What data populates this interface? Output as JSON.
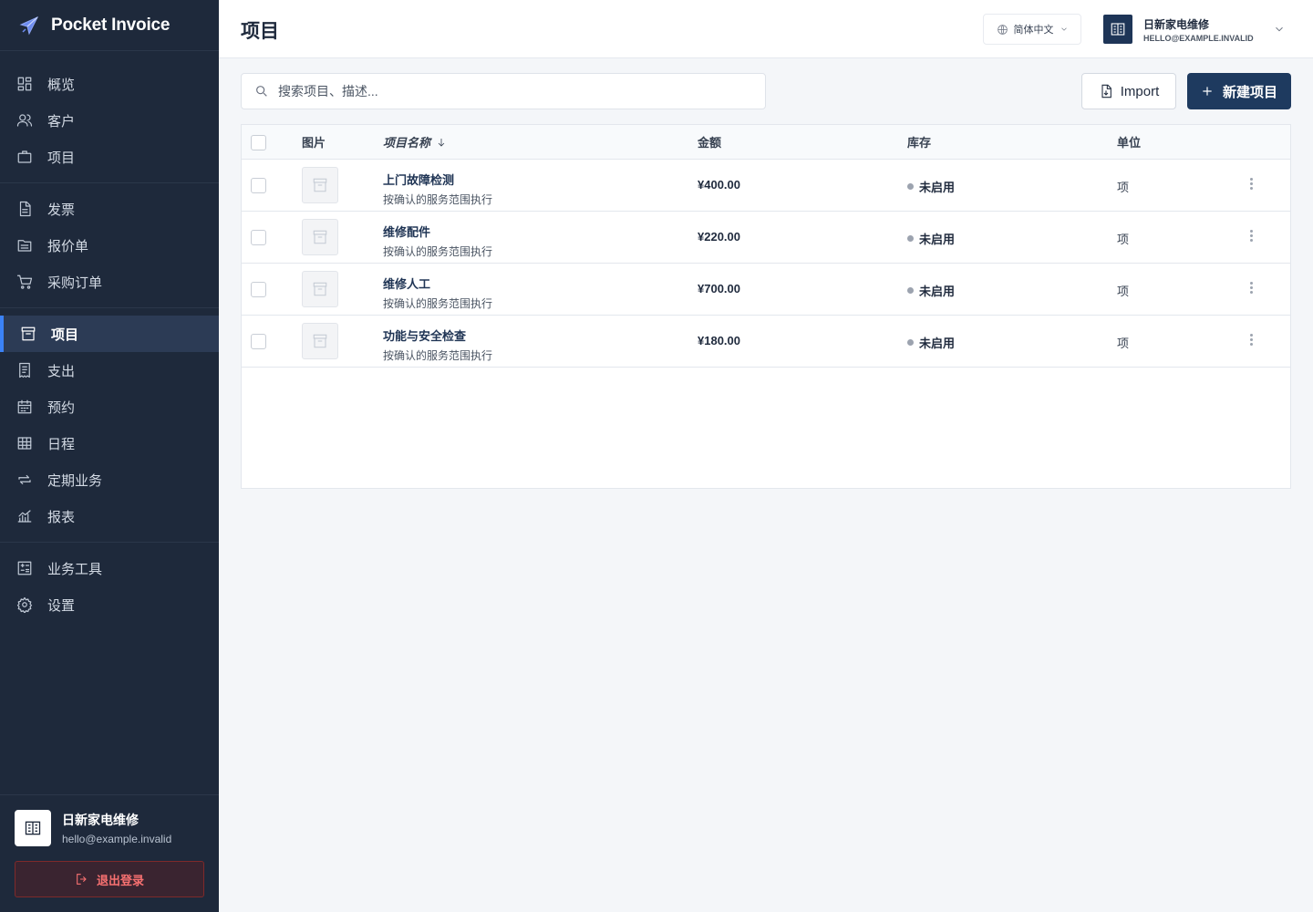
{
  "brand": {
    "name": "Pocket Invoice",
    "icon": "paper-plane-icon"
  },
  "sidebar": {
    "groups": [
      [
        {
          "label": "概览",
          "icon": "grid-icon"
        },
        {
          "label": "客户",
          "icon": "users-icon"
        },
        {
          "label": "项目",
          "icon": "briefcase-icon"
        }
      ],
      [
        {
          "label": "发票",
          "icon": "document-icon"
        },
        {
          "label": "报价单",
          "icon": "folder-icon"
        },
        {
          "label": "采购订单",
          "icon": "cart-icon"
        }
      ],
      [
        {
          "label": "项目",
          "icon": "archive-icon",
          "active": true
        },
        {
          "label": "支出",
          "icon": "receipt-icon"
        },
        {
          "label": "预约",
          "icon": "calendar-icon"
        },
        {
          "label": "日程",
          "icon": "table-icon"
        },
        {
          "label": "定期业务",
          "icon": "repeat-icon"
        },
        {
          "label": "报表",
          "icon": "chart-icon"
        }
      ],
      [
        {
          "label": "业务工具",
          "icon": "calculator-icon"
        },
        {
          "label": "设置",
          "icon": "gear-icon"
        }
      ]
    ],
    "account": {
      "name": "日新家电维修",
      "email": "hello@example.invalid"
    },
    "logout_label": "退出登录"
  },
  "header": {
    "title": "项目",
    "language": "简体中文",
    "user": {
      "name": "日新家电维修",
      "email": "HELLO@EXAMPLE.INVALID"
    }
  },
  "toolbar": {
    "search_placeholder": "搜索项目、描述...",
    "import_label": "Import",
    "new_label": "新建项目"
  },
  "table": {
    "columns": {
      "image": "图片",
      "name": "项目名称",
      "amount": "金额",
      "stock": "库存",
      "unit": "单位"
    },
    "rows": [
      {
        "name": "上门故障检测",
        "desc": "按确认的服务范围执行",
        "amount": "¥400.00",
        "stock": "未启用",
        "unit": "项"
      },
      {
        "name": "维修配件",
        "desc": "按确认的服务范围执行",
        "amount": "¥220.00",
        "stock": "未启用",
        "unit": "项"
      },
      {
        "name": "维修人工",
        "desc": "按确认的服务范围执行",
        "amount": "¥700.00",
        "stock": "未启用",
        "unit": "项"
      },
      {
        "name": "功能与安全检查",
        "desc": "按确认的服务范围执行",
        "amount": "¥180.00",
        "stock": "未启用",
        "unit": "项"
      }
    ]
  },
  "colors": {
    "sidebar_bg": "#1e293b",
    "accent": "#3b82f6",
    "primary_button": "#1e3a5f",
    "danger": "#f87171"
  }
}
